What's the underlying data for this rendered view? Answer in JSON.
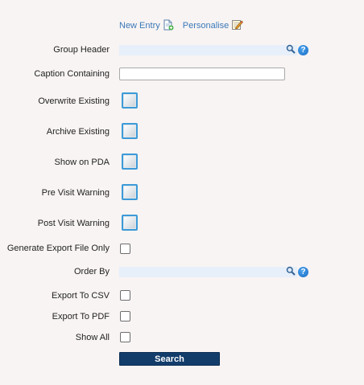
{
  "toolbar": {
    "new_entry_label": "New Entry",
    "new_entry_icon": "new-document-icon",
    "personalise_label": "Personalise",
    "personalise_icon": "edit-notepad-icon"
  },
  "form": {
    "group_header_label": "Group Header",
    "group_header_value": "",
    "caption_containing_label": "Caption Containing",
    "caption_containing_value": "",
    "overwrite_existing_label": "Overwrite Existing",
    "archive_existing_label": "Archive Existing",
    "show_on_pda_label": "Show on PDA",
    "pre_visit_warning_label": "Pre Visit Warning",
    "post_visit_warning_label": "Post Visit Warning",
    "generate_export_file_only_label": "Generate Export File Only",
    "order_by_label": "Order By",
    "order_by_value": "",
    "export_to_csv_label": "Export To CSV",
    "export_to_pdf_label": "Export To PDF",
    "show_all_label": "Show All"
  },
  "icons": {
    "lookup": "magnifier-icon",
    "help": "help-icon",
    "help_glyph": "?"
  },
  "actions": {
    "search_label": "Search"
  },
  "colors": {
    "link": "#3a78b8",
    "lookup_field_bg": "#e7effa",
    "checkbox_border": "#3c9ad8",
    "button_bg": "#123d6b",
    "page_bg": "#f8f4f3"
  }
}
